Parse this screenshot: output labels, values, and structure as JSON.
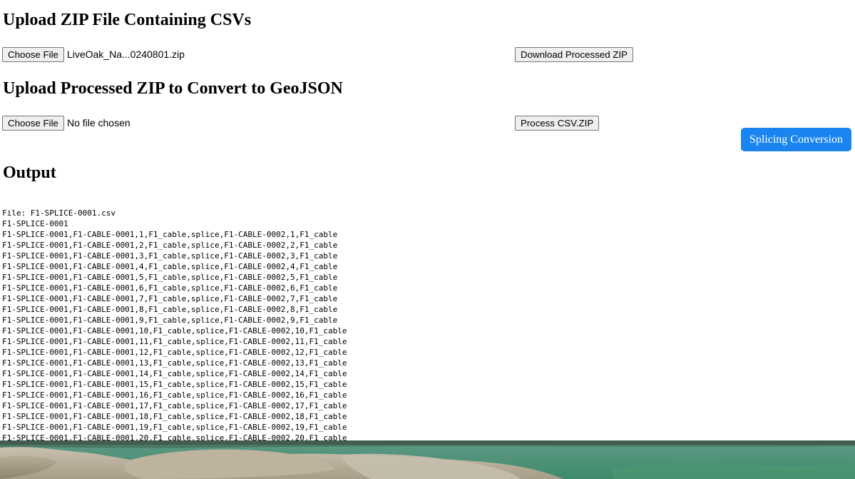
{
  "upload_csv": {
    "heading": "Upload ZIP File Containing CSVs",
    "choose_file_label": "Choose File",
    "selected_file": "LiveOak_Na...0240801.zip",
    "download_button": "Download Processed ZIP"
  },
  "upload_processed": {
    "heading": "Upload Processed ZIP to Convert to GeoJSON",
    "choose_file_label": "Choose File",
    "selected_file": "No file chosen",
    "process_button": "Process CSV.ZIP"
  },
  "splicing_button": "Splicing Conversion",
  "output": {
    "heading": "Output",
    "lines": [
      "File: F1-SPLICE-0001.csv",
      "F1-SPLICE-0001",
      "F1-SPLICE-0001,F1-CABLE-0001,1,F1_cable,splice,F1-CABLE-0002,1,F1_cable",
      "F1-SPLICE-0001,F1-CABLE-0001,2,F1_cable,splice,F1-CABLE-0002,2,F1_cable",
      "F1-SPLICE-0001,F1-CABLE-0001,3,F1_cable,splice,F1-CABLE-0002,3,F1_cable",
      "F1-SPLICE-0001,F1-CABLE-0001,4,F1_cable,splice,F1-CABLE-0002,4,F1_cable",
      "F1-SPLICE-0001,F1-CABLE-0001,5,F1_cable,splice,F1-CABLE-0002,5,F1_cable",
      "F1-SPLICE-0001,F1-CABLE-0001,6,F1_cable,splice,F1-CABLE-0002,6,F1_cable",
      "F1-SPLICE-0001,F1-CABLE-0001,7,F1_cable,splice,F1-CABLE-0002,7,F1_cable",
      "F1-SPLICE-0001,F1-CABLE-0001,8,F1_cable,splice,F1-CABLE-0002,8,F1_cable",
      "F1-SPLICE-0001,F1-CABLE-0001,9,F1_cable,splice,F1-CABLE-0002,9,F1_cable",
      "F1-SPLICE-0001,F1-CABLE-0001,10,F1_cable,splice,F1-CABLE-0002,10,F1_cable",
      "F1-SPLICE-0001,F1-CABLE-0001,11,F1_cable,splice,F1-CABLE-0002,11,F1_cable",
      "F1-SPLICE-0001,F1-CABLE-0001,12,F1_cable,splice,F1-CABLE-0002,12,F1_cable",
      "F1-SPLICE-0001,F1-CABLE-0001,13,F1_cable,splice,F1-CABLE-0002,13,F1_cable",
      "F1-SPLICE-0001,F1-CABLE-0001,14,F1_cable,splice,F1-CABLE-0002,14,F1_cable",
      "F1-SPLICE-0001,F1-CABLE-0001,15,F1_cable,splice,F1-CABLE-0002,15,F1_cable",
      "F1-SPLICE-0001,F1-CABLE-0001,16,F1_cable,splice,F1-CABLE-0002,16,F1_cable",
      "F1-SPLICE-0001,F1-CABLE-0001,17,F1_cable,splice,F1-CABLE-0002,17,F1_cable",
      "F1-SPLICE-0001,F1-CABLE-0001,18,F1_cable,splice,F1-CABLE-0002,18,F1_cable",
      "F1-SPLICE-0001,F1-CABLE-0001,19,F1_cable,splice,F1-CABLE-0002,19,F1_cable",
      "F1-SPLICE-0001,F1-CABLE-0001,20,F1_cable,splice,F1-CABLE-0002,20,F1_cable"
    ]
  },
  "colors": {
    "accent_button": "#1a85f0",
    "native_button_bg": "#efefef"
  }
}
